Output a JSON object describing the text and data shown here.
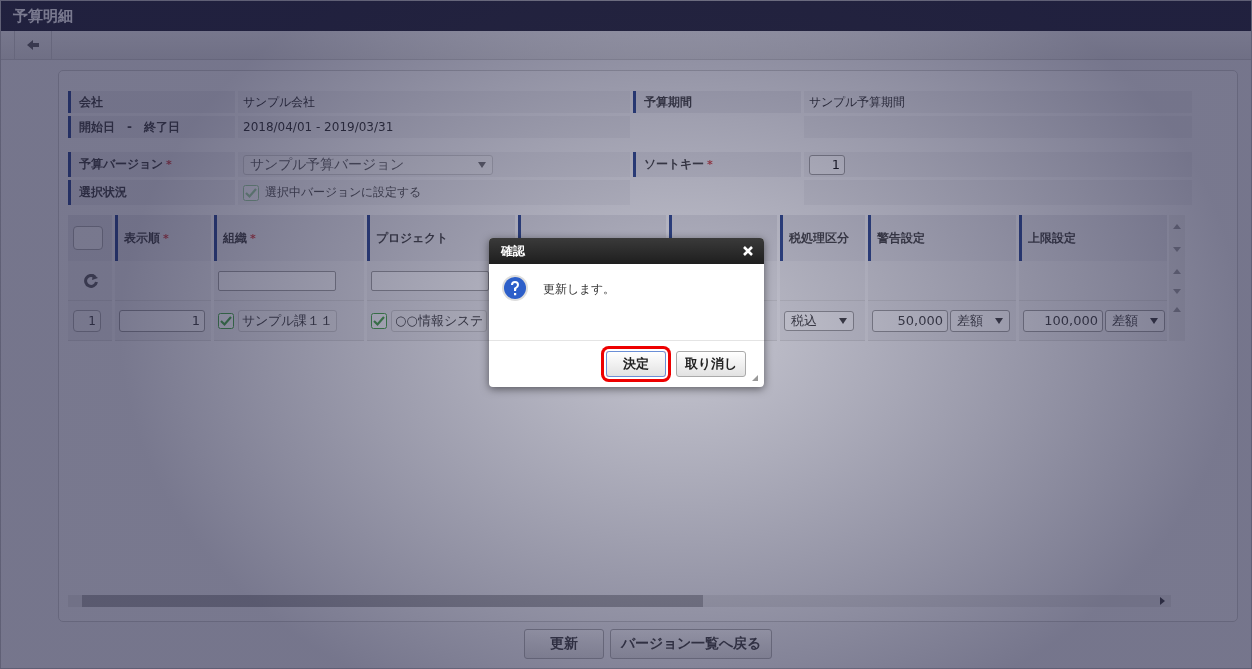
{
  "window": {
    "title": "予算明細"
  },
  "summary_rows": [
    [
      {
        "label": "会社",
        "value": "サンプル会社"
      },
      {
        "label": "予算期間",
        "value": "サンプル予算期間"
      }
    ],
    [
      {
        "label": "開始日　-　終了日",
        "value": "2018/04/01 - 2019/03/31"
      }
    ]
  ],
  "form_rows": [
    [
      {
        "label": "予算バージョン",
        "mark": "*",
        "kind": "select",
        "value": "サンプル予算バージョン",
        "disabled": true
      },
      {
        "label": "ソートキー",
        "mark": "*",
        "kind": "number",
        "value": "1"
      }
    ],
    [
      {
        "label": "選択状況",
        "kind": "checkbox",
        "text": "選択中バージョンに設定する",
        "checked": true,
        "disabled": true
      }
    ]
  ],
  "table": {
    "select_all": {
      "checked": false
    },
    "columns": [
      {
        "label": "表示順",
        "mark": "*"
      },
      {
        "label": "組織",
        "mark": "*"
      },
      {
        "label": "プロジェクト"
      },
      {},
      {},
      {
        "label": "税処理区分"
      },
      {
        "label": "警告設定"
      },
      {
        "label": "上限設定"
      }
    ],
    "filters": [
      {
        "kind": "empty"
      },
      {
        "kind": "input"
      },
      {
        "kind": "input"
      },
      {
        "kind": "empty"
      },
      {
        "kind": "empty"
      },
      {
        "kind": "empty"
      },
      {
        "kind": "empty"
      },
      {
        "kind": "empty"
      }
    ],
    "rows": [
      {
        "row_number": "1",
        "cells": [
          {
            "kind": "number",
            "value": "1"
          },
          {
            "kind": "lookup",
            "checked": true,
            "value": "サンプル課１１"
          },
          {
            "kind": "lookup",
            "checked": true,
            "value": "○○情報システ"
          },
          {
            "kind": "empty"
          },
          {
            "kind": "empty"
          },
          {
            "kind": "select",
            "value": "税込"
          },
          {
            "kind": "amount",
            "value": "50,000",
            "mode": "差額"
          },
          {
            "kind": "amount",
            "value": "100,000",
            "mode": "差額"
          }
        ]
      }
    ]
  },
  "footer_buttons": [
    "更新",
    "バージョン一覧へ戻る"
  ],
  "dialog": {
    "title": "確認",
    "message": "更新します。",
    "buttons": [
      {
        "label": "決定",
        "focused": true
      },
      {
        "label": "取り消し",
        "focused": false
      }
    ]
  }
}
